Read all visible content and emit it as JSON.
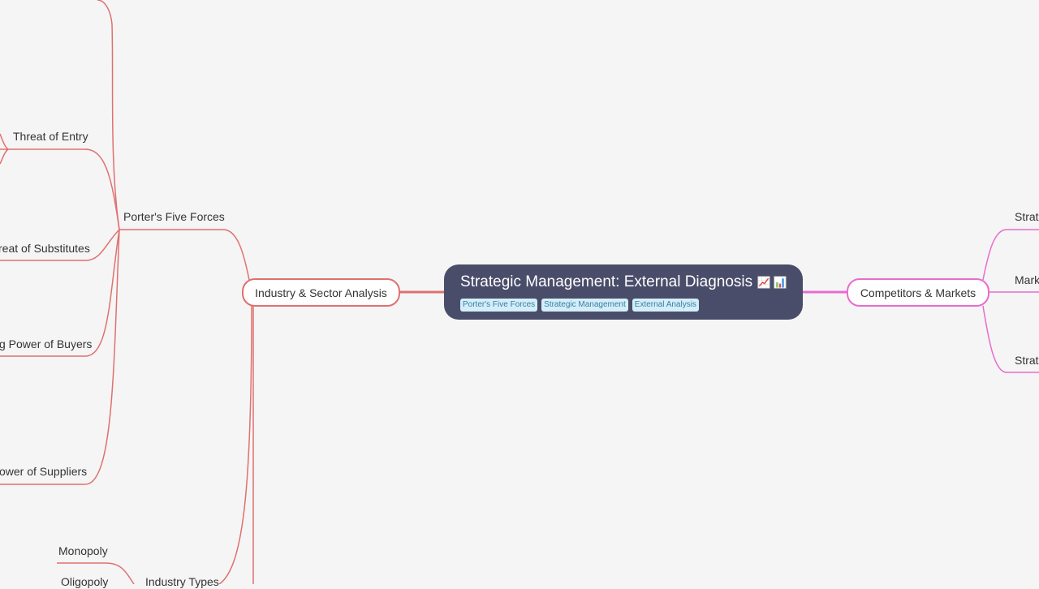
{
  "colors": {
    "background": "#f5f5f5",
    "root_fill": "#4a4d6a",
    "left_branch": "#e07070",
    "right_branch": "#e86ccf",
    "tag_fill": "#d3eef8",
    "tag_text": "#3a7da6"
  },
  "root": {
    "title": "Strategic Management: External Diagnosis",
    "icons": [
      "chart-increasing-icon",
      "bar-chart-icon"
    ],
    "tags": [
      "Porter's Five Forces",
      "Strategic Management",
      "External Analysis"
    ]
  },
  "left": {
    "branch": "Industry & Sector Analysis",
    "porter": {
      "label": "Porter's Five Forces",
      "children": [
        "Threat of Entry",
        "reat of Substitutes",
        "g Power of Buyers",
        "ower of Suppliers"
      ]
    },
    "industry_types": {
      "label": "Industry Types",
      "children": [
        "Monopoly",
        "Oligopoly"
      ]
    }
  },
  "right": {
    "branch": "Competitors & Markets",
    "children": [
      "Strat",
      "Mark",
      "Strat"
    ]
  }
}
